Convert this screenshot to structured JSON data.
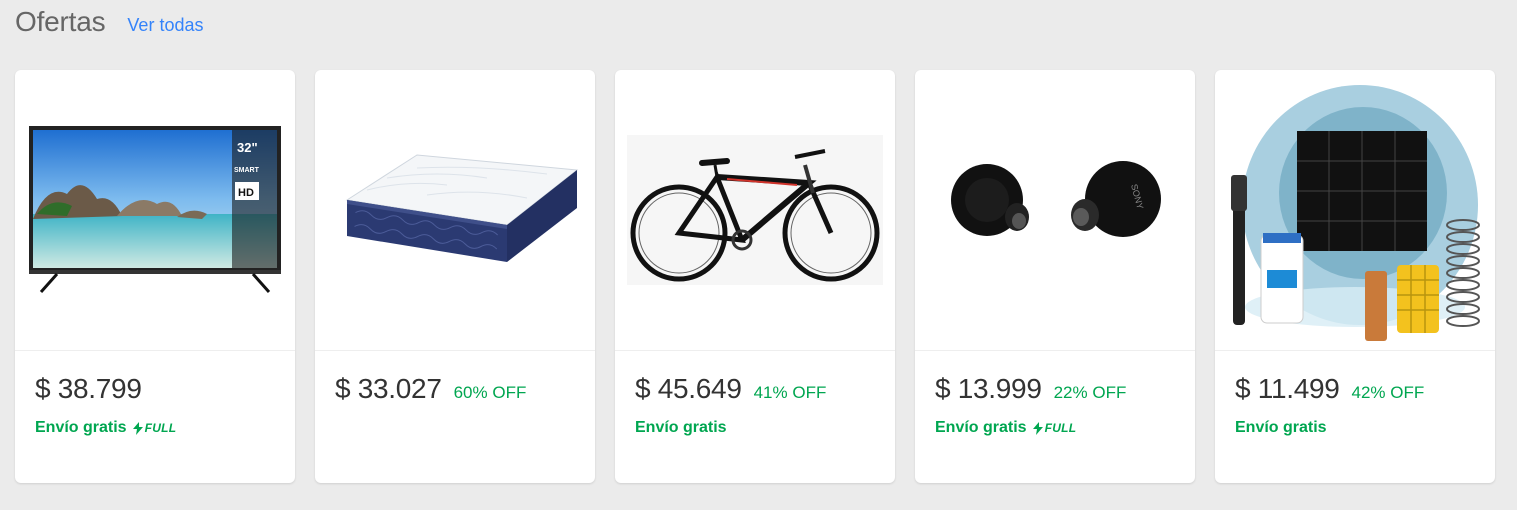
{
  "section": {
    "title": "Ofertas",
    "see_all": "Ver todas"
  },
  "colors": {
    "background": "#ebebeb",
    "link": "#3483fa",
    "green": "#00a650"
  },
  "products": [
    {
      "image_icon": "tv-product-image",
      "price": "$ 38.799",
      "discount": "",
      "shipping": "Envío gratis",
      "full_label": "FULL"
    },
    {
      "image_icon": "mattress-product-image",
      "price": "$ 33.027",
      "discount": "60% OFF",
      "shipping": "",
      "full_label": ""
    },
    {
      "image_icon": "bicycle-product-image",
      "price": "$ 45.649",
      "discount": "41% OFF",
      "shipping": "Envío gratis",
      "full_label": ""
    },
    {
      "image_icon": "earbuds-product-image",
      "price": "$ 13.999",
      "discount": "22% OFF",
      "shipping": "Envío gratis",
      "full_label": "FULL"
    },
    {
      "image_icon": "pool-ionizer-product-image",
      "price": "$ 11.499",
      "discount": "42% OFF",
      "shipping": "Envío gratis",
      "full_label": ""
    }
  ]
}
